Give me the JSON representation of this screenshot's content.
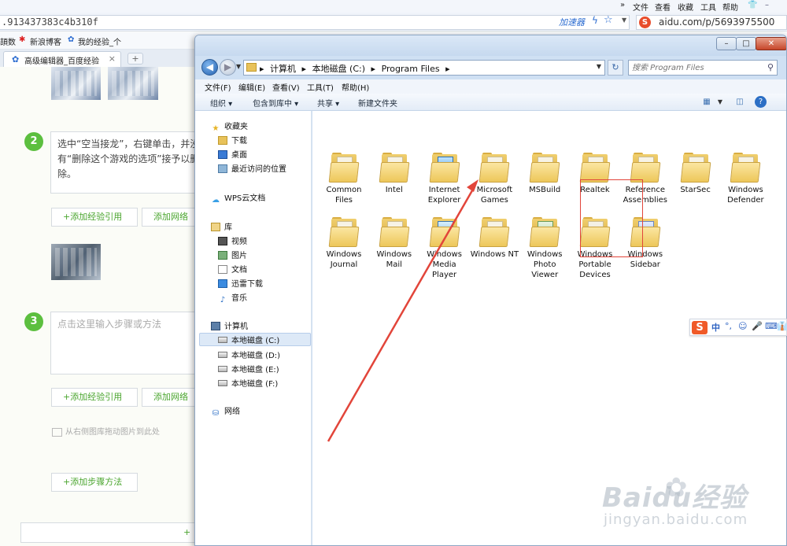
{
  "browser": {
    "menu": [
      "»",
      "文件",
      "查看",
      "收藏",
      "工具",
      "帮助"
    ],
    "address_fragment": ".913437383c4b310f",
    "accelerator_label": "加速器",
    "url_fragment": "aidu.com/p/5693975500",
    "favorites": [
      "頡数",
      "新浪博客",
      "我的经验_个"
    ],
    "active_tab": "高级编辑器_百度经验",
    "new_tab": "+",
    "close_tab": "×"
  },
  "editor": {
    "steps": [
      {
        "number": "2",
        "text": "选中“空当接龙”，右键单击，并没有“删除这个游戏的选项”接予以删除。",
        "placeholder": ""
      },
      {
        "number": "3",
        "text": "",
        "placeholder": "点击这里输入步骤或方法"
      }
    ],
    "add_quote_label": "+添加经验引用",
    "add_network_label": "添加网络",
    "drag_hint": "从右侧图库拖动图片到此处",
    "add_step_label": "+添加步骤方法",
    "bottom_label": "+"
  },
  "explorer": {
    "window_buttons": {
      "minimize": "–",
      "maximize": "□",
      "close": "✕"
    },
    "path": [
      "计算机",
      "本地磁盘 (C:)",
      "Program Files"
    ],
    "search_placeholder": "搜索 Program Files",
    "menubar": [
      "文件(F)",
      "编辑(E)",
      "查看(V)",
      "工具(T)",
      "帮助(H)"
    ],
    "commands": [
      "组织 ▾",
      "包含到库中 ▾",
      "共享 ▾",
      "新建文件夹"
    ],
    "nav": {
      "favorites_header": "收藏夹",
      "favorites": [
        "下载",
        "桌面",
        "最近访问的位置"
      ],
      "cloud": "WPS云文档",
      "libraries_header": "库",
      "libraries": [
        "视频",
        "图片",
        "文档",
        "迅雷下载",
        "音乐"
      ],
      "computer_header": "计算机",
      "drives": [
        "本地磁盘 (C:)",
        "本地磁盘 (D:)",
        "本地磁盘 (E:)",
        "本地磁盘 (F:)"
      ],
      "network": "网络"
    },
    "folders": [
      {
        "name": "Common Files",
        "icon": "folder-icon"
      },
      {
        "name": "Intel",
        "icon": "folder-icon"
      },
      {
        "name": "Internet Explorer",
        "icon": "ie-folder-icon"
      },
      {
        "name": "Microsoft Games",
        "icon": "folder-icon"
      },
      {
        "name": "MSBuild",
        "icon": "folder-icon"
      },
      {
        "name": "Realtek",
        "icon": "folder-icon"
      },
      {
        "name": "Reference Assemblies",
        "icon": "folder-icon"
      },
      {
        "name": "StarSec",
        "icon": "folder-icon"
      },
      {
        "name": "Windows Defender",
        "icon": "folder-icon"
      },
      {
        "name": "Windows Journal",
        "icon": "folder-icon"
      },
      {
        "name": "Windows Mail",
        "icon": "folder-icon"
      },
      {
        "name": "Windows Media Player",
        "icon": "media-folder-icon"
      },
      {
        "name": "Windows NT",
        "icon": "folder-icon"
      },
      {
        "name": "Windows Photo Viewer",
        "icon": "photo-folder-icon"
      },
      {
        "name": "Windows Portable Devices",
        "icon": "portable-folder-icon"
      },
      {
        "name": "Windows Sidebar",
        "icon": "sidebar-folder-icon"
      }
    ],
    "highlighted_folder": "Microsoft Games"
  },
  "ime": {
    "logo": "S",
    "items": [
      "中",
      "°,",
      "☺",
      "🎤",
      "⌨",
      "👔"
    ]
  },
  "watermark": {
    "brand": "Baidu经验",
    "url": "jingyan.baidu.com"
  },
  "colors": {
    "accent_green": "#5cbf3f",
    "annotation_red": "#e2453a",
    "explorer_frame": "#cfe0f3"
  }
}
